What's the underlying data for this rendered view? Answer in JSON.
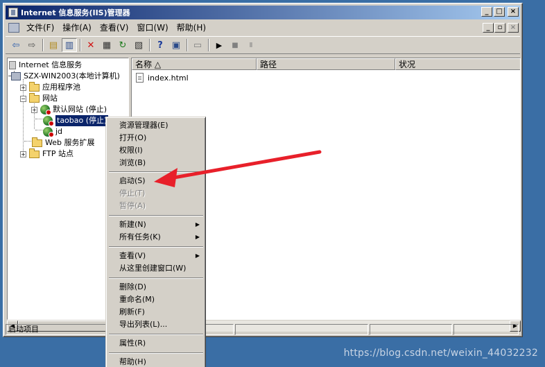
{
  "window": {
    "title": "Internet 信息服务(IIS)管理器",
    "controls": {
      "minimize": "_",
      "maximize": "□",
      "close": "×"
    }
  },
  "menubar": {
    "items": [
      "文件(F)",
      "操作(A)",
      "查看(V)",
      "窗口(W)",
      "帮助(H)"
    ],
    "child_controls": {
      "minimize": "_",
      "restore": "▫",
      "close": "×"
    }
  },
  "toolbar": {
    "icons": [
      "back-icon",
      "forward-icon",
      "up-folder-icon",
      "show-tree-icon",
      "delete-icon",
      "properties-icon",
      "refresh-icon",
      "export-icon",
      "help-icon",
      "console-icon",
      "computer-icon",
      "play-icon",
      "stop-icon",
      "pause-icon"
    ],
    "glyphs": {
      "back": "⇦",
      "forward": "⇨",
      "up": "▤",
      "tree": "▥",
      "delete": "✕",
      "properties": "▦",
      "refresh": "↻",
      "export": "▧",
      "help": "?",
      "console": "▣",
      "computer": "▭",
      "play": "▶",
      "stop": "■",
      "pause": "Ⅱ"
    }
  },
  "tree": {
    "root": "Internet 信息服务",
    "server": "SZX-WIN2003(本地计算机)",
    "app_pools": "应用程序池",
    "websites": "网站",
    "default_site": "默认网站 (停止)",
    "taobao": "taobao (停止)",
    "jd": "jd",
    "web_ext": "Web 服务扩展",
    "ftp": "FTP 站点",
    "expand_glyph": "+",
    "collapse_glyph": "−"
  },
  "list": {
    "columns": {
      "name": "名称 △",
      "path": "路径",
      "status": "状况"
    },
    "rows": [
      {
        "name": "index.html"
      }
    ]
  },
  "context_menu": {
    "explorer": "资源管理器(E)",
    "open": "打开(O)",
    "permissions": "权限(I)",
    "browse": "浏览(B)",
    "start": "启动(S)",
    "stop": "停止(T)",
    "pause": "暂停(A)",
    "new": "新建(N)",
    "all_tasks": "所有任务(K)",
    "view": "查看(V)",
    "new_window": "从这里创建窗口(W)",
    "delete": "删除(D)",
    "rename": "重命名(M)",
    "refresh": "刷新(F)",
    "export_list": "导出列表(L)...",
    "properties": "属性(R)",
    "help": "帮助(H)",
    "submenu_arrow": "▶"
  },
  "status": {
    "text": "启动项目"
  },
  "scroll": {
    "left": "◀",
    "right": "▶"
  },
  "watermark": "https://blog.csdn.net/weixin_44032232",
  "colors": {
    "titlebar": "#0a246a",
    "desktop": "#3a6ea5",
    "arrow": "#e8202a"
  }
}
